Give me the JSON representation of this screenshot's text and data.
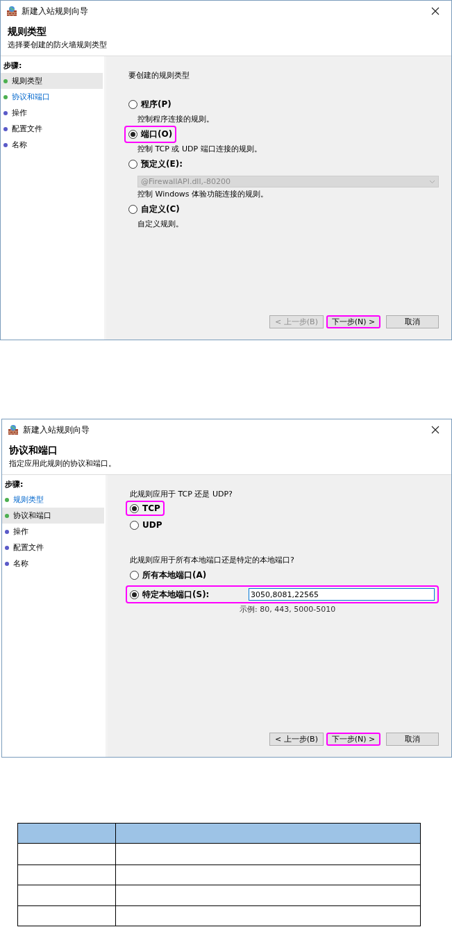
{
  "dialogs": [
    {
      "title": "新建入站规则向导",
      "heading": "规则类型",
      "subtitle": "选择要创建的防火墙规则类型",
      "steps_label": "步骤:",
      "steps": [
        {
          "label": "规则类型",
          "selected": true,
          "link": false,
          "color": "#4caf50"
        },
        {
          "label": "协议和端口",
          "selected": false,
          "link": true,
          "color": "#4caf50"
        },
        {
          "label": "操作",
          "selected": false,
          "link": false,
          "color": "#5a5ac8"
        },
        {
          "label": "配置文件",
          "selected": false,
          "link": false,
          "color": "#5a5ac8"
        },
        {
          "label": "名称",
          "selected": false,
          "link": false,
          "color": "#5a5ac8"
        }
      ],
      "sections": [
        {
          "prompt": "要创建的规则类型",
          "options": [
            {
              "label": "程序(P)",
              "description": "控制程序连接的规则。",
              "selected": false,
              "highlighted": false
            },
            {
              "label": "端口(O)",
              "description": "控制 TCP 或 UDP 端口连接的规则。",
              "selected": true,
              "highlighted": true
            },
            {
              "label": "预定义(E):",
              "dropdown": {
                "value": "@FirewallAPI.dll,-80200",
                "disabled": true
              },
              "description": "控制 Windows 体验功能连接的规则。",
              "selected": false,
              "highlighted": false
            },
            {
              "label": "自定义(C)",
              "description": "自定义规则。",
              "selected": false,
              "highlighted": false
            }
          ]
        }
      ],
      "buttons": [
        {
          "label": "< 上一步(B)",
          "disabled": true,
          "highlighted": false
        },
        {
          "label": "下一步(N) >",
          "disabled": false,
          "highlighted": true
        },
        {
          "label": "取消",
          "disabled": false,
          "highlighted": false
        }
      ]
    },
    {
      "title": "新建入站规则向导",
      "heading": "协议和端口",
      "subtitle": "指定应用此规则的协议和端口。",
      "steps_label": "步骤:",
      "steps": [
        {
          "label": "规则类型",
          "selected": false,
          "link": true,
          "color": "#4caf50"
        },
        {
          "label": "协议和端口",
          "selected": true,
          "link": false,
          "color": "#4caf50"
        },
        {
          "label": "操作",
          "selected": false,
          "link": false,
          "color": "#5a5ac8"
        },
        {
          "label": "配置文件",
          "selected": false,
          "link": false,
          "color": "#5a5ac8"
        },
        {
          "label": "名称",
          "selected": false,
          "link": false,
          "color": "#5a5ac8"
        }
      ],
      "sections": [
        {
          "prompt": "此规则应用于 TCP 还是 UDP?",
          "options": [
            {
              "label": "TCP",
              "selected": true,
              "highlighted": true
            },
            {
              "label": "UDP",
              "selected": false,
              "highlighted": false
            }
          ]
        },
        {
          "prompt": "此规则应用于所有本地端口还是特定的本地端口?",
          "options": [
            {
              "label": "所有本地端口(A)",
              "selected": false,
              "highlighted": false
            },
            {
              "label": "特定本地端口(S):",
              "selected": true,
              "highlighted": true,
              "field": {
                "value": "3050,8081,22565"
              },
              "example": "示例: 80, 443, 5000-5010"
            }
          ]
        }
      ],
      "buttons": [
        {
          "label": "< 上一步(B)",
          "disabled": false,
          "highlighted": false
        },
        {
          "label": "下一步(N) >",
          "disabled": false,
          "highlighted": true
        },
        {
          "label": "取消",
          "disabled": false,
          "highlighted": false
        }
      ]
    }
  ]
}
